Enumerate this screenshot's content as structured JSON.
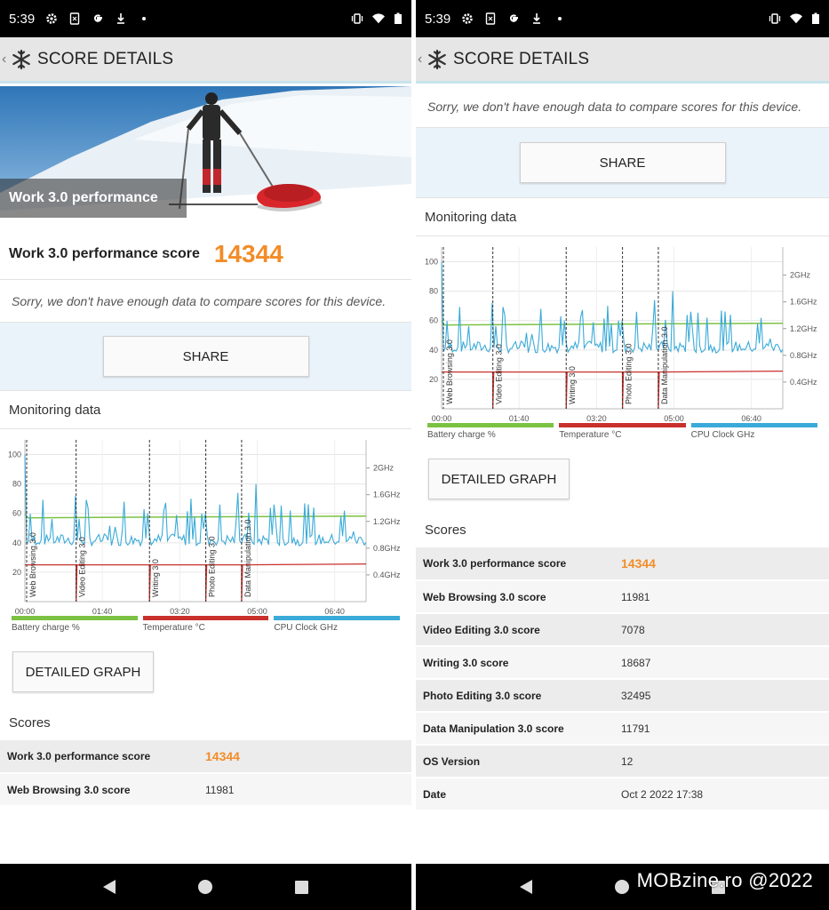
{
  "status": {
    "time": "5:39"
  },
  "header": {
    "title": "SCORE DETAILS"
  },
  "hero": {
    "caption": "Work 3.0 performance"
  },
  "overall": {
    "label": "Work 3.0 performance score",
    "value": "14344"
  },
  "compare_note": "Sorry, we don't have enough data to compare scores for this device.",
  "share_label": "SHARE",
  "monitoring": {
    "title": "Monitoring data"
  },
  "chart_data": {
    "type": "line",
    "x_ticks": [
      "00:00",
      "01:40",
      "03:20",
      "05:00",
      "06:40"
    ],
    "y_left_ticks": [
      "20",
      "40",
      "60",
      "80",
      "100"
    ],
    "y_right_ticks": [
      "0.4GHz",
      "0.8GHz",
      "1.2GHz",
      "1.6GHz",
      "2GHz"
    ],
    "segments": [
      "Web Browsing 3.0",
      "Video Editing 3.0",
      "Writing 3.0",
      "Photo Editing 3.0",
      "Data Manipulation 3.0"
    ],
    "legend": [
      {
        "name": "Battery charge %",
        "color": "#7cc242"
      },
      {
        "name": "Temperature °C",
        "color": "#c9302c"
      },
      {
        "name": "CPU Clock GHz",
        "color": "#3aaad8"
      }
    ]
  },
  "detail_label": "DETAILED GRAPH",
  "scores": {
    "title": "Scores",
    "rows": [
      {
        "k": "Work 3.0 performance score",
        "v": "14344"
      },
      {
        "k": "Web Browsing 3.0 score",
        "v": "11981"
      },
      {
        "k": "Video Editing 3.0 score",
        "v": "7078"
      },
      {
        "k": "Writing 3.0 score",
        "v": "18687"
      },
      {
        "k": "Photo Editing 3.0 score",
        "v": "32495"
      },
      {
        "k": "Data Manipulation 3.0 score",
        "v": "11791"
      },
      {
        "k": "OS Version",
        "v": "12"
      },
      {
        "k": "Date",
        "v": "Oct 2 2022 17:38"
      }
    ]
  },
  "watermark": "MOBzine.ro @2022"
}
